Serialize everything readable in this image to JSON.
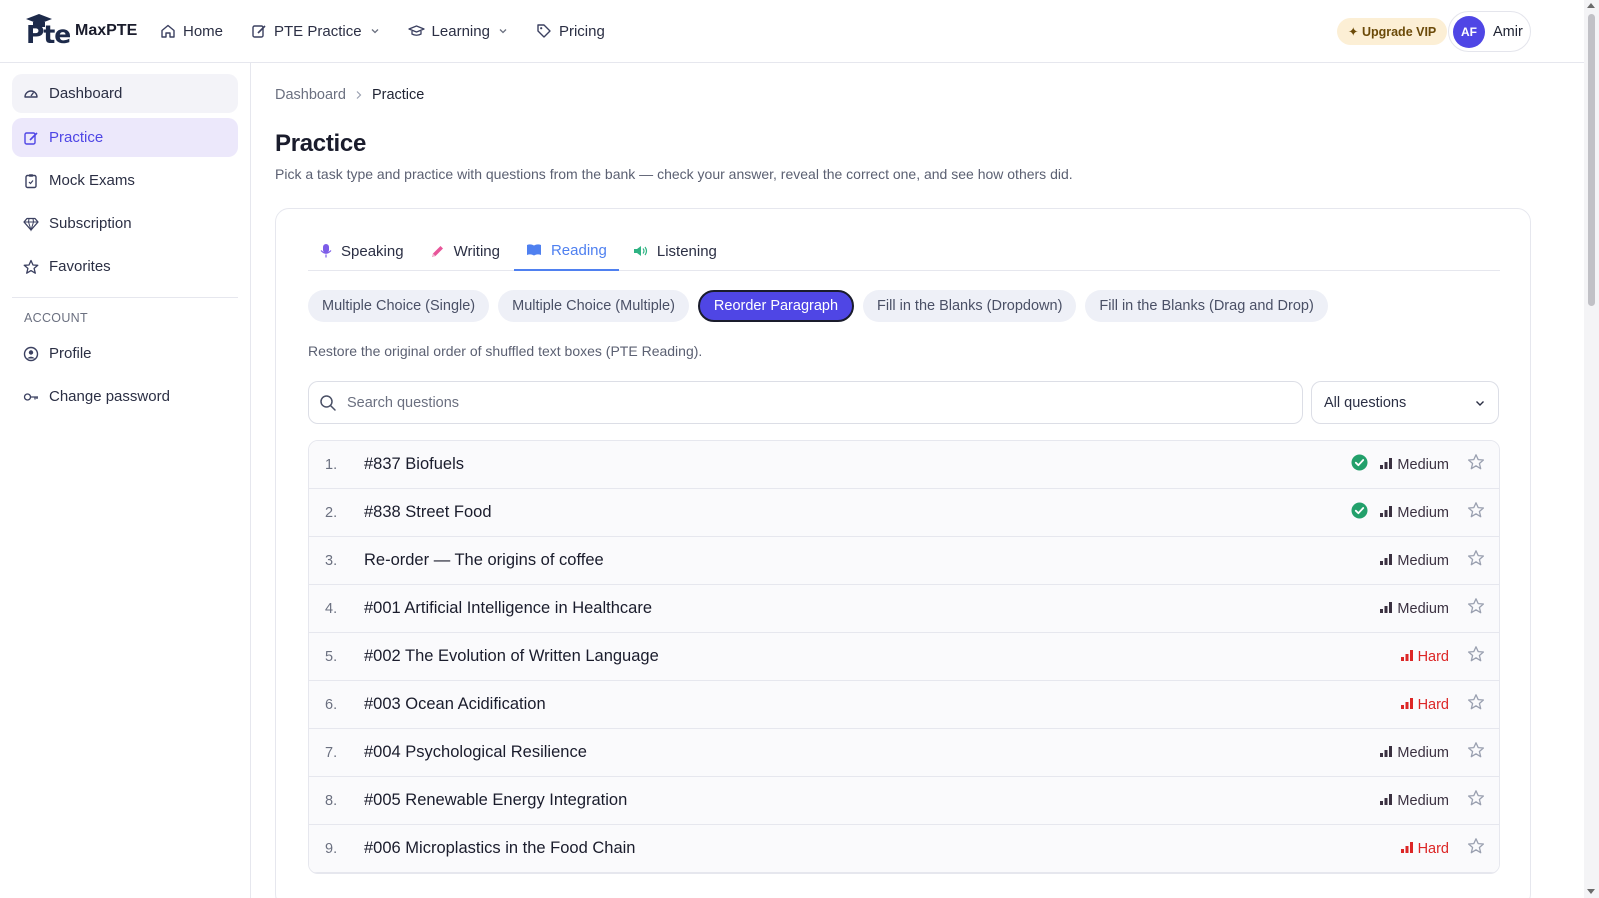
{
  "brand": {
    "name": "MaxPTE",
    "logo_text": "Pte"
  },
  "nav": {
    "items": [
      {
        "label": "Home",
        "icon": "home-icon"
      },
      {
        "label": "PTE Practice",
        "icon": "edit-icon",
        "dropdown": true
      },
      {
        "label": "Learning",
        "icon": "graduation-cap-icon",
        "dropdown": true
      },
      {
        "label": "Pricing",
        "icon": "tag-icon"
      }
    ],
    "upgrade_label": "✦ Upgrade VIP",
    "user": {
      "initials": "AF",
      "name": "Amir"
    }
  },
  "sidebar": {
    "items": [
      {
        "label": "Dashboard",
        "icon": "gauge-icon"
      },
      {
        "label": "Practice",
        "icon": "edit-icon",
        "active": true
      },
      {
        "label": "Mock Exams",
        "icon": "clipboard-icon"
      },
      {
        "label": "Subscription",
        "icon": "diamond-icon"
      },
      {
        "label": "Favorites",
        "icon": "star-icon"
      }
    ],
    "section_label": "ACCOUNT",
    "account_items": [
      {
        "label": "Profile",
        "icon": "user-circle-icon"
      },
      {
        "label": "Change password",
        "icon": "key-icon"
      }
    ]
  },
  "breadcrumb": {
    "root": "Dashboard",
    "current": "Practice"
  },
  "page": {
    "title": "Practice",
    "subtitle": "Pick a task type and practice with questions from the bank — check your answer, reveal the correct one, and see how others did."
  },
  "tabs": [
    {
      "label": "Speaking",
      "icon": "microphone-icon"
    },
    {
      "label": "Writing",
      "icon": "pencil-icon"
    },
    {
      "label": "Reading",
      "icon": "book-icon",
      "active": true
    },
    {
      "label": "Listening",
      "icon": "speaker-icon"
    }
  ],
  "task_types": [
    {
      "label": "Multiple Choice (Single)"
    },
    {
      "label": "Multiple Choice (Multiple)"
    },
    {
      "label": "Reorder Paragraph",
      "active": true
    },
    {
      "label": "Fill in the Blanks (Dropdown)"
    },
    {
      "label": "Fill in the Blanks (Drag and Drop)"
    }
  ],
  "task_description": "Restore the original order of shuffled text boxes (PTE Reading).",
  "search": {
    "placeholder": "Search questions",
    "value": ""
  },
  "filter": {
    "selected": "All questions"
  },
  "colors": {
    "accent": "#4f46e5",
    "tab_active": "#4f80f0",
    "done": "#22a06b",
    "hard": "#dc2626",
    "medium": "#3a3040"
  },
  "questions": [
    {
      "num": "1.",
      "title": "#837 Biofuels",
      "done": true,
      "difficulty": "Medium"
    },
    {
      "num": "2.",
      "title": "#838 Street Food",
      "done": true,
      "difficulty": "Medium"
    },
    {
      "num": "3.",
      "title": "Re-order — The origins of coffee",
      "done": false,
      "difficulty": "Medium"
    },
    {
      "num": "4.",
      "title": "#001 Artificial Intelligence in Healthcare",
      "done": false,
      "difficulty": "Medium"
    },
    {
      "num": "5.",
      "title": "#002 The Evolution of Written Language",
      "done": false,
      "difficulty": "Hard"
    },
    {
      "num": "6.",
      "title": "#003 Ocean Acidification",
      "done": false,
      "difficulty": "Hard"
    },
    {
      "num": "7.",
      "title": "#004 Psychological Resilience",
      "done": false,
      "difficulty": "Medium"
    },
    {
      "num": "8.",
      "title": "#005 Renewable Energy Integration",
      "done": false,
      "difficulty": "Medium"
    },
    {
      "num": "9.",
      "title": "#006 Microplastics in the Food Chain",
      "done": false,
      "difficulty": "Hard"
    }
  ]
}
